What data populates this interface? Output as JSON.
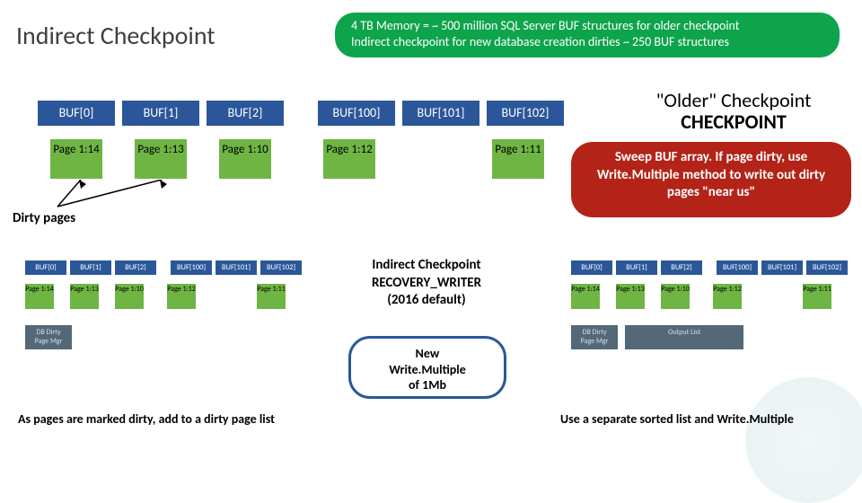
{
  "title": "Indirect Checkpoint",
  "banner": {
    "line1": "4 TB Memory = ~ 500 million SQL Server BUF structures for older checkpoint",
    "line2": "Indirect checkpoint for new database creation dirties ~ 250 BUF structures"
  },
  "older": {
    "line1": "\"Older\" Checkpoint",
    "line2": "CHECKPOINT"
  },
  "red_pill": "Sweep BUF array. If page dirty, use Write.Multiple method to write out dirty pages \"near us\"",
  "dirty_label": "Dirty pages",
  "big_bufs": [
    "BUF[0]",
    "BUF[1]",
    "BUF[2]",
    "BUF[100]",
    "BUF[101]",
    "BUF[102]"
  ],
  "big_pages": [
    "Page 1:14",
    "Page 1:13",
    "Page 1:10",
    "Page 1:12",
    "",
    "Page 1:11"
  ],
  "small_bufs": [
    "BUF[0]",
    "BUF[1]",
    "BUF[2]",
    "BUF[100]",
    "BUF[101]",
    "BUF[102]"
  ],
  "small_pages": [
    "Page 1:14",
    "Page 1:13",
    "Page 1:10",
    "Page 1:12",
    "",
    "Page 1:11"
  ],
  "grey_left": {
    "a": "DB Dirty Page Mgr"
  },
  "grey_right": {
    "a": "DB Dirty Page Mgr",
    "b": "Output List"
  },
  "center": {
    "l1": "Indirect Checkpoint",
    "l2": "RECOVERY_WRITER",
    "l3": "(2016 default)"
  },
  "blue_pill": {
    "l1": "New",
    "l2": "Write.Multiple",
    "l3": "of 1Mb"
  },
  "bottom_left": "As pages are marked dirty, add to a dirty page list",
  "bottom_right": "Use a separate sorted list and Write.Multiple"
}
